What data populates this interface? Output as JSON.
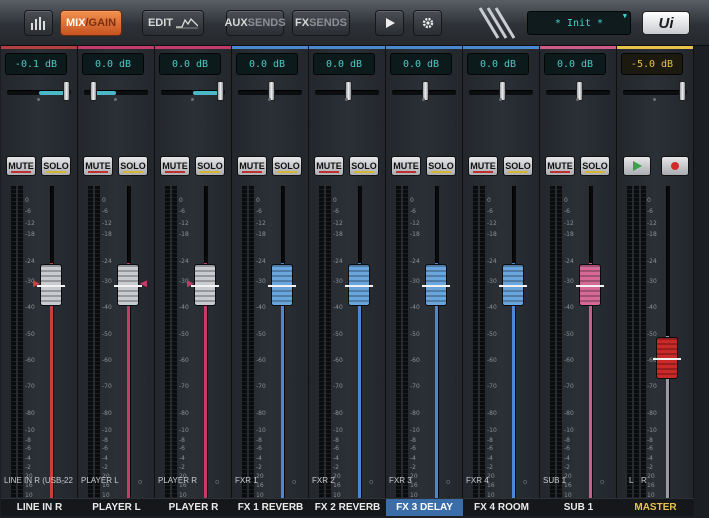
{
  "toolbar": {
    "mixer_icon_label": "",
    "mix_label": "MIX",
    "gain_label": "/GAIN",
    "edit_label": "EDIT",
    "aux_label": "AUX",
    "aux_sends_label": "SENDS",
    "fx_label": "FX",
    "fx_sends_label": "SENDS",
    "play_icon": "play-icon",
    "settings_icon": "gear-icon",
    "preset_name": "* Init *",
    "brand": "Ui"
  },
  "buttons": {
    "mute": "MUTE",
    "solo": "SOLO"
  },
  "meter_ticks": [
    "0",
    "-6",
    "-12",
    "-18",
    "-24",
    "-30",
    "-40",
    "-50",
    "-60",
    "-70",
    "-80",
    "-10",
    "-8",
    "-6",
    "-4",
    "-2",
    "20",
    "16",
    "10",
    "4",
    "2"
  ],
  "channels": [
    {
      "name": "LINE IN R",
      "source": "LINE IN R (USB-22",
      "db": "-0.1 dB",
      "color": "#c94040",
      "cap": "silver",
      "level": 0.82,
      "pan": "right",
      "active": false,
      "top_color": "#b34040"
    },
    {
      "name": "PLAYER L",
      "source": "PLAYER L",
      "db": "0.0 dB",
      "color": "#c23b6a",
      "cap": "silver",
      "level": 0.82,
      "pan": "left",
      "active": false,
      "top_color": "#c23b6a"
    },
    {
      "name": "PLAYER R",
      "source": "PLAYER R",
      "db": "0.0 dB",
      "color": "#c23b6a",
      "cap": "silver",
      "level": 0.82,
      "pan": "right",
      "active": false,
      "top_color": "#c23b6a"
    },
    {
      "name": "FX 1 REVERB",
      "source": "FXR 1",
      "db": "0.0 dB",
      "color": "#4a88cf",
      "cap": "blue",
      "level": 0.82,
      "pan": "center",
      "active": false,
      "top_color": "#4a88cf"
    },
    {
      "name": "FX 2 REVERB",
      "source": "FXR 2",
      "db": "0.0 dB",
      "color": "#4a88cf",
      "cap": "blue",
      "level": 0.82,
      "pan": "center",
      "active": false,
      "top_color": "#4a88cf"
    },
    {
      "name": "FX 3 DELAY",
      "source": "FXR 3",
      "db": "0.0 dB",
      "color": "#4a88cf",
      "cap": "blue",
      "level": 0.82,
      "pan": "center",
      "active": true,
      "top_color": "#4a88cf"
    },
    {
      "name": "FX 4 ROOM",
      "source": "FXR 4",
      "db": "0.0 dB",
      "color": "#4a88cf",
      "cap": "blue",
      "level": 0.82,
      "pan": "center",
      "active": false,
      "top_color": "#4a88cf"
    },
    {
      "name": "SUB 1",
      "source": "SUB 1",
      "db": "0.0 dB",
      "color": "#cf5b8a",
      "cap": "pink",
      "level": 0.82,
      "pan": "center",
      "active": false,
      "top_color": "#cf5b8a"
    }
  ],
  "master": {
    "name": "MASTER",
    "db": "-5.0 dB",
    "left": "L",
    "right": "R",
    "play_icon": "play-icon",
    "record_icon": "record-icon",
    "level": 0.6,
    "top_color": "#e8c24a"
  },
  "colors": {
    "accent": "#e8783a",
    "lcd": "#4ec8c4",
    "master": "#e8c24a",
    "active_label": "#3b6ea8"
  }
}
